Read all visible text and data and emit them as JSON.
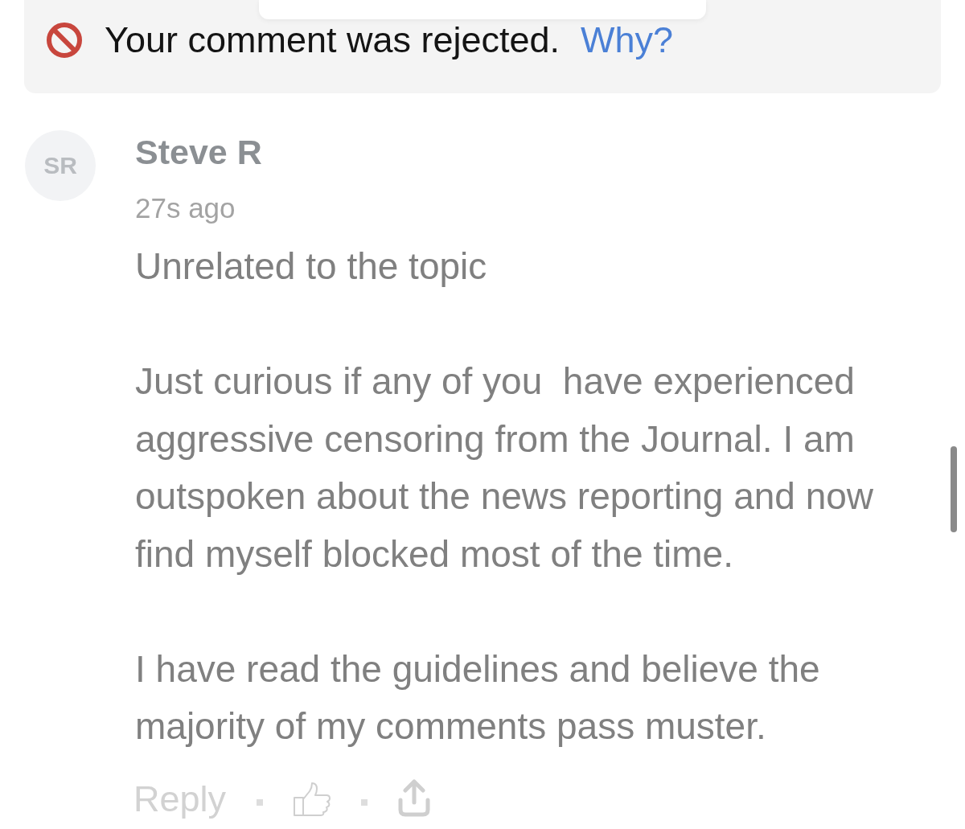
{
  "notice": {
    "message": "Your comment was rejected.",
    "link": "Why?"
  },
  "comment": {
    "avatar_initials": "SR",
    "author": "Steve R",
    "time": "27s ago",
    "paragraphs": [
      "Unrelated to the topic",
      "Just curious if any of you  have experienced aggressive censoring from the Journal. I am outspoken about the news reporting and now find myself blocked most of the time.",
      "I have read the guidelines and believe the majority of my comments pass muster."
    ],
    "reply": "Reply"
  }
}
